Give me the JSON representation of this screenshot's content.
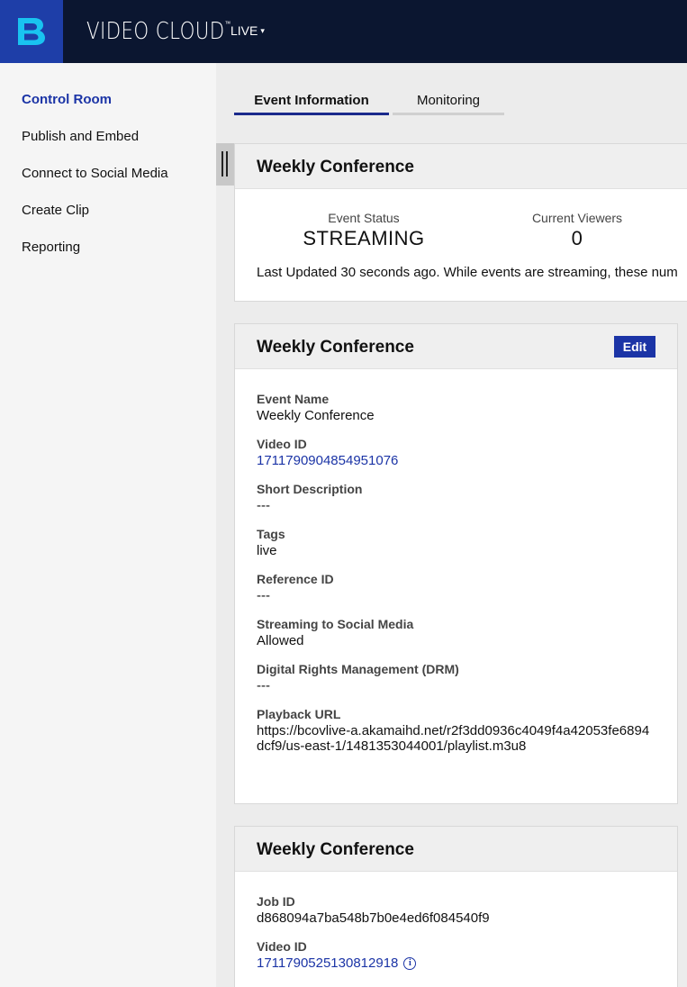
{
  "header": {
    "app_name": "VIDEO CLOUD",
    "trademark": "™",
    "module_menu": "LIVE",
    "caret": "▾",
    "logo_letter": "B"
  },
  "sidebar": {
    "items": [
      {
        "label": "Control Room",
        "active": true
      },
      {
        "label": "Publish and Embed",
        "active": false
      },
      {
        "label": "Connect to Social Media",
        "active": false
      },
      {
        "label": "Create Clip",
        "active": false
      },
      {
        "label": "Reporting",
        "active": false
      }
    ]
  },
  "tabs": [
    {
      "label": "Event Information",
      "active": true
    },
    {
      "label": "Monitoring",
      "active": false
    }
  ],
  "status_card": {
    "title": "Weekly Conference",
    "event_status_label": "Event Status",
    "event_status_value": "STREAMING",
    "viewers_label": "Current Viewers",
    "viewers_value": "0",
    "updated_text": "Last Updated 30 seconds ago. While events are streaming, these num"
  },
  "details_card": {
    "title": "Weekly Conference",
    "edit_label": "Edit",
    "fields": [
      {
        "label": "Event Name",
        "value": "Weekly Conference"
      },
      {
        "label": "Video ID",
        "value": "1711790904854951076"
      },
      {
        "label": "Short Description",
        "value": "---"
      },
      {
        "label": "Tags",
        "value": "live"
      },
      {
        "label": "Reference ID",
        "value": "---"
      },
      {
        "label": "Streaming to Social Media",
        "value": "Allowed"
      },
      {
        "label": "Digital Rights Management (DRM)",
        "value": "---"
      },
      {
        "label": "Playback URL",
        "value": "https://bcovlive-a.akamaihd.net/r2f3dd0936c4049f4a42053fe6894dcf9/us-east-1/1481353044001/playlist.m3u8"
      }
    ]
  },
  "job_card": {
    "title": "Weekly Conference",
    "fields": [
      {
        "label": "Job ID",
        "value": "d868094a7ba548b7b0e4ed6f084540f9"
      },
      {
        "label": "Video ID",
        "value": "1711790525130812918"
      }
    ]
  },
  "colors": {
    "topbar": "#0b1630",
    "logo_bg": "#1e3ea8",
    "accent": "#1b34a6"
  }
}
